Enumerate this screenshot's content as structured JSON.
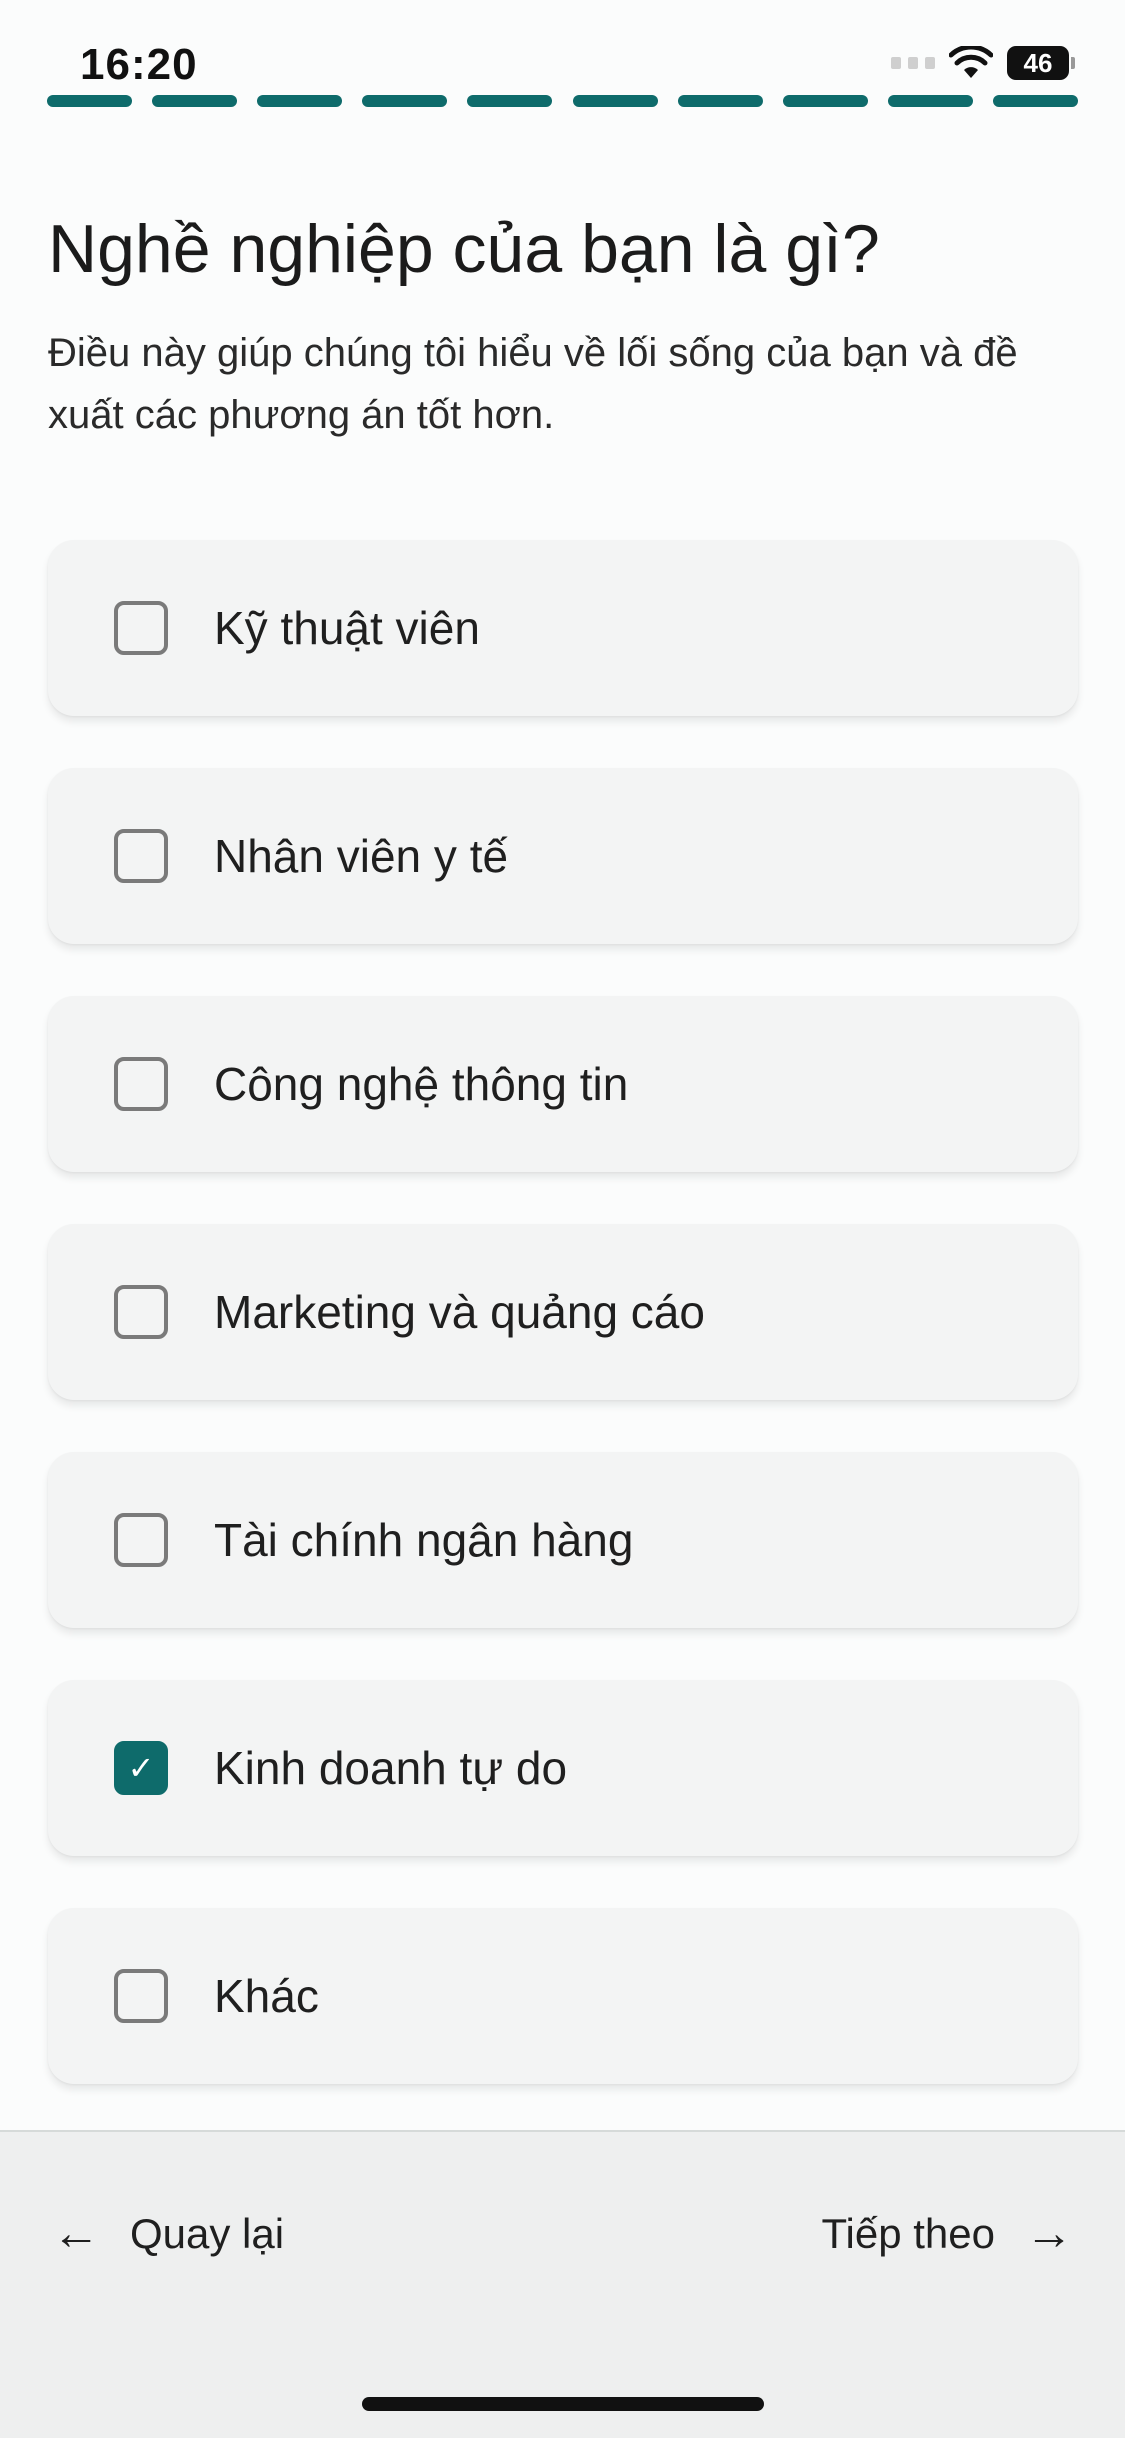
{
  "status_bar": {
    "time": "16:20",
    "battery": "46"
  },
  "progress": {
    "segments_total": 10,
    "segments_completed": 10
  },
  "header": {
    "title": "Nghề nghiệp của bạn là gì?",
    "subtitle": "Điều này giúp chúng tôi hiểu về lối sống của bạn và đề xuất các phương án tốt hơn."
  },
  "options": [
    {
      "label": "Kỹ thuật viên",
      "checked": false
    },
    {
      "label": "Nhân viên y tế",
      "checked": false
    },
    {
      "label": "Công nghệ thông tin",
      "checked": false
    },
    {
      "label": "Marketing và quảng cáo",
      "checked": false
    },
    {
      "label": "Tài chính ngân hàng",
      "checked": false
    },
    {
      "label": "Kinh doanh tự do",
      "checked": true
    },
    {
      "label": "Khác",
      "checked": false
    }
  ],
  "footer": {
    "back_label": "Quay lại",
    "next_label": "Tiếp theo"
  },
  "colors": {
    "accent": "#0e6b6b",
    "card_bg": "#f3f4f4",
    "footer_bg": "#eeefef"
  }
}
